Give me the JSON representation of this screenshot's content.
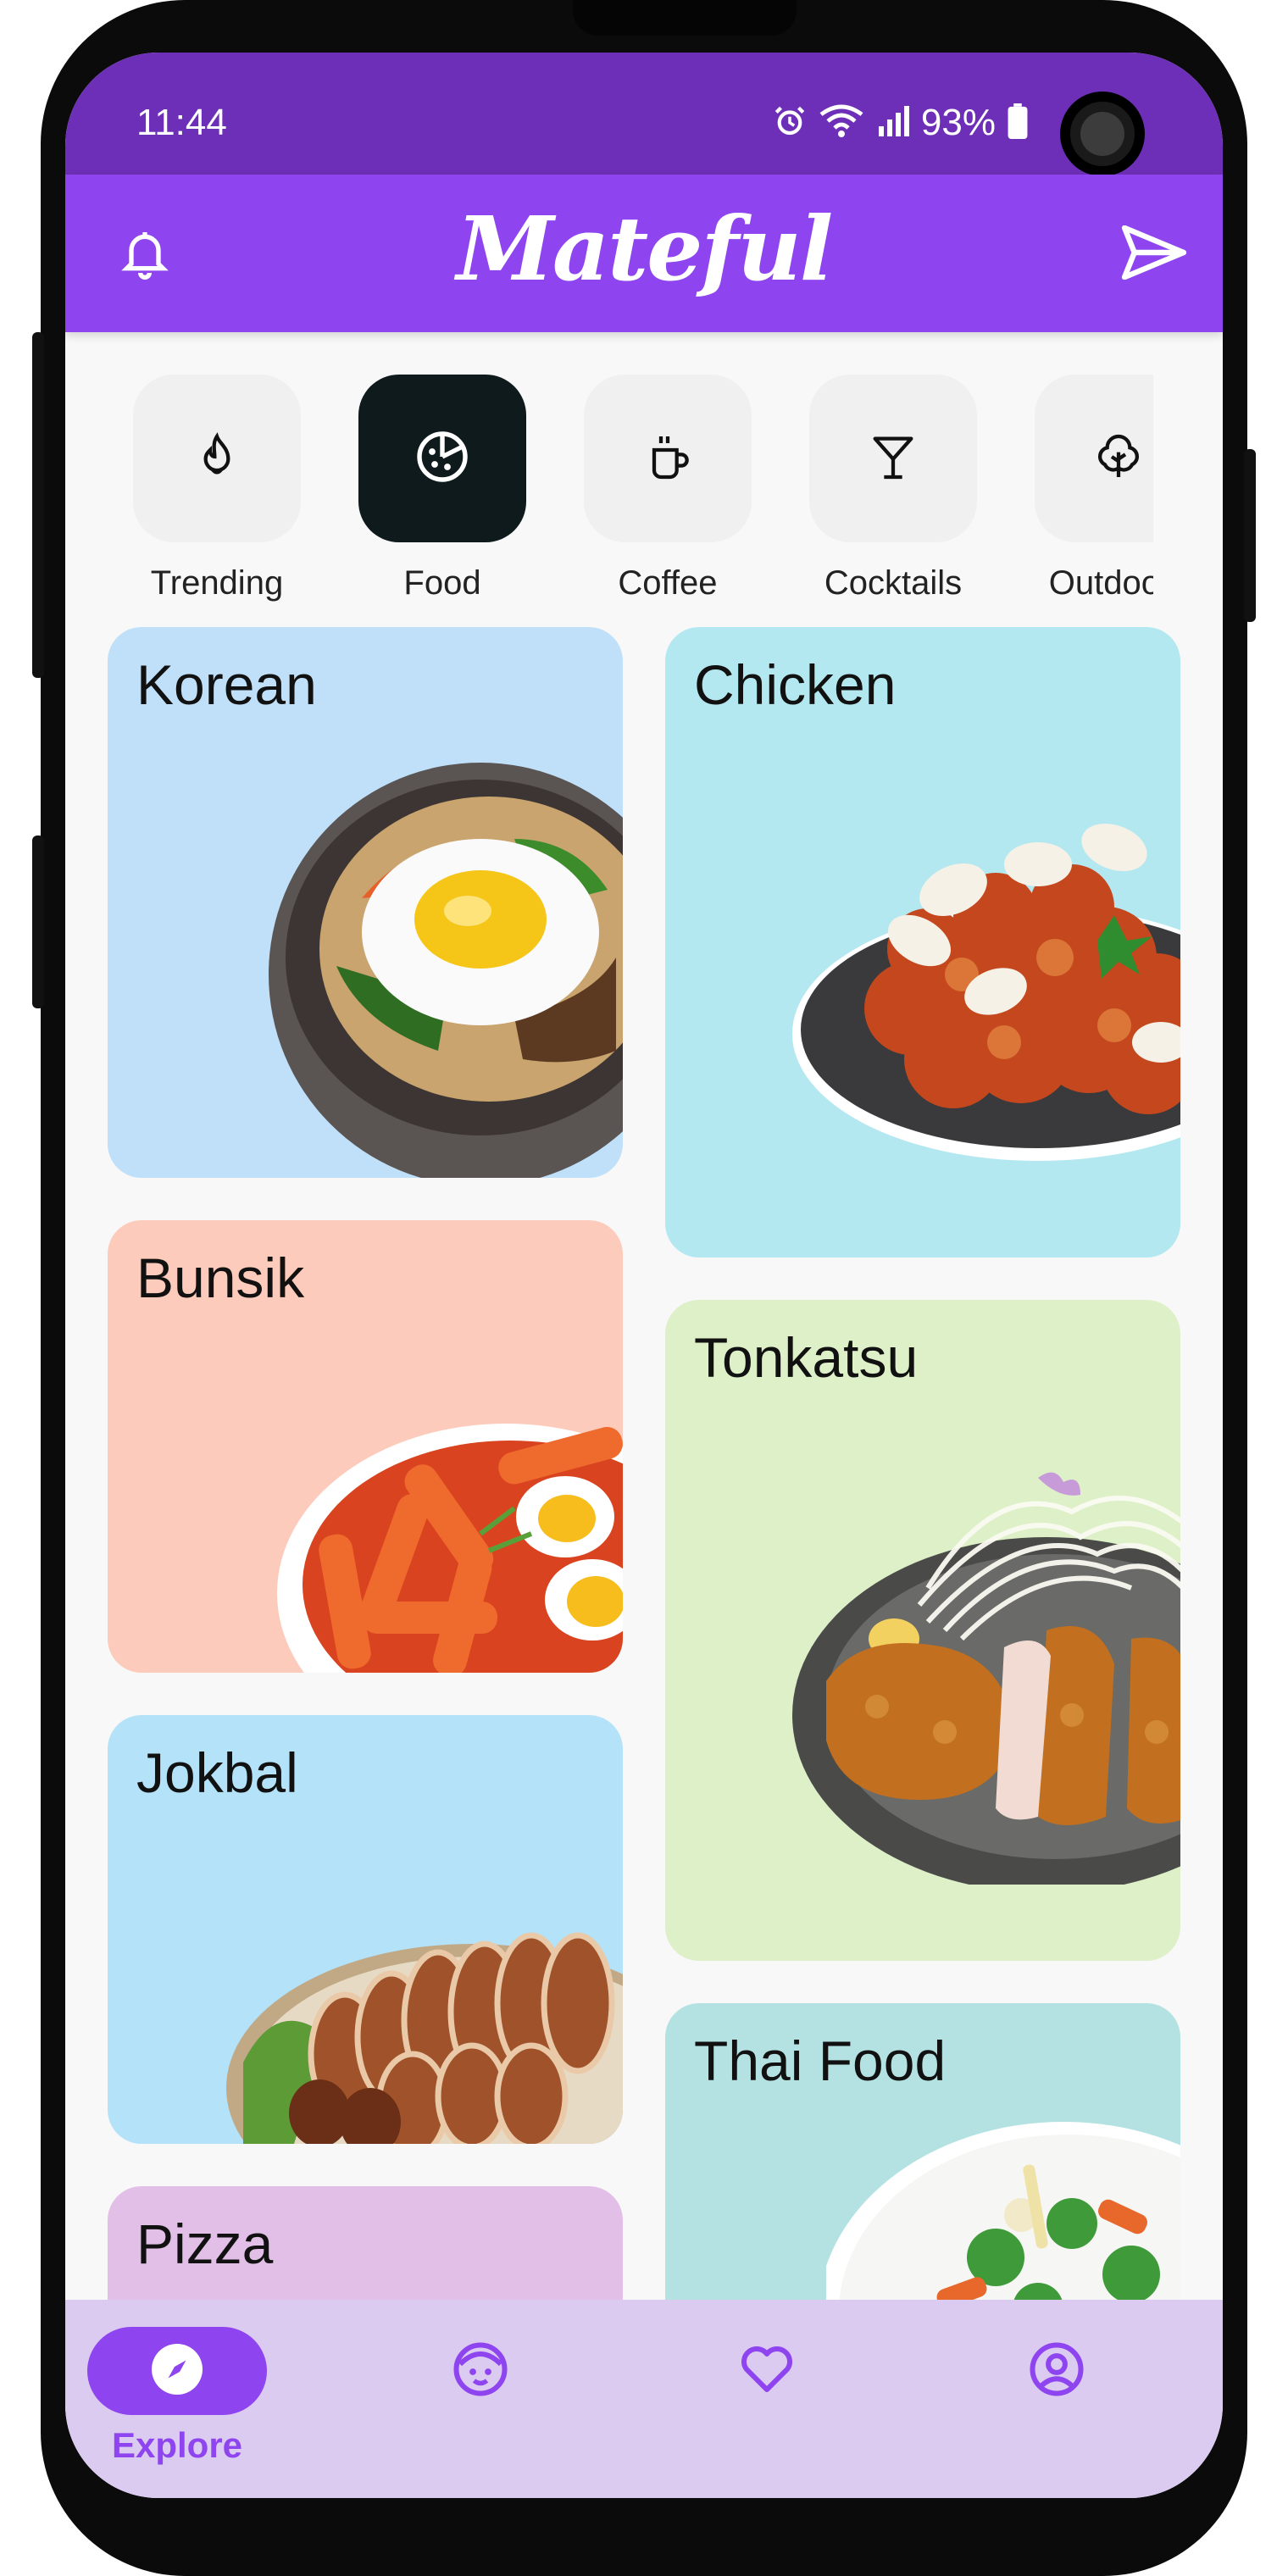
{
  "status_bar": {
    "time": "11:44",
    "battery": "93%"
  },
  "app_bar": {
    "title": "Mateful",
    "left_icon": "bell-icon",
    "right_icon": "send-icon"
  },
  "categories": [
    {
      "label": "Trending",
      "icon": "flame-icon",
      "selected": false
    },
    {
      "label": "Food",
      "icon": "pizza-icon",
      "selected": true
    },
    {
      "label": "Coffee",
      "icon": "coffee-cup-icon",
      "selected": false
    },
    {
      "label": "Cocktails",
      "icon": "cocktail-glass-icon",
      "selected": false
    },
    {
      "label": "Outdoors",
      "icon": "tree-icon",
      "selected": false
    }
  ],
  "cards": [
    {
      "title": "Korean",
      "color": "#bfe0f8"
    },
    {
      "title": "Chicken",
      "color": "#b4e8f0"
    },
    {
      "title": "Bunsik",
      "color": "#fdcbbb"
    },
    {
      "title": "Tonkatsu",
      "color": "#def0c8"
    },
    {
      "title": "Jokbal",
      "color": "#b4e2f8"
    },
    {
      "title": "Thai Food",
      "color": "#b4e2e2"
    },
    {
      "title": "Pizza",
      "color": "#e2bfe6"
    }
  ],
  "bottom_nav": [
    {
      "label": "Explore",
      "icon": "compass-icon",
      "active": true
    },
    {
      "label": "",
      "icon": "face-icon",
      "active": false
    },
    {
      "label": "",
      "icon": "heart-icon",
      "active": false
    },
    {
      "label": "",
      "icon": "account-icon",
      "active": false
    }
  ],
  "colors": {
    "status_bar": "#6d2fb7",
    "app_bar": "#8e44ef",
    "nav_background": "#dccbf1",
    "accent": "#8e44ef"
  }
}
